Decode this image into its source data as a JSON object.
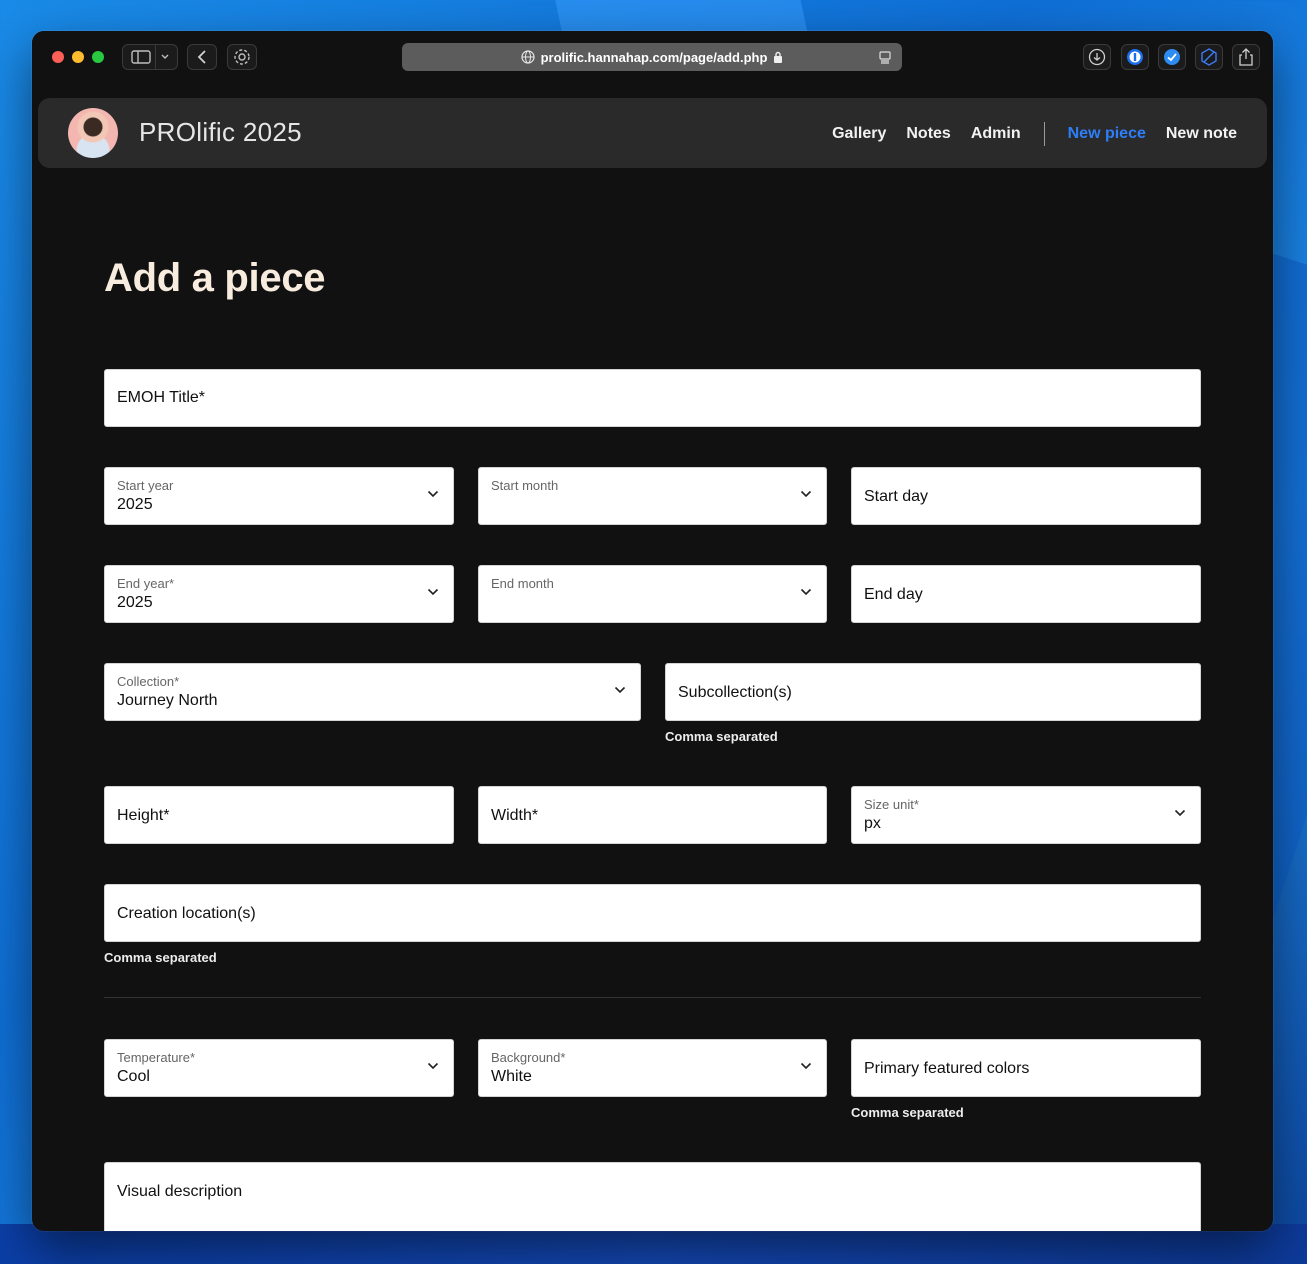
{
  "browser": {
    "url": "prolific.hannahap.com/page/add.php"
  },
  "site": {
    "brand": "PROlific 2025",
    "nav": {
      "gallery": "Gallery",
      "notes": "Notes",
      "admin": "Admin",
      "new_piece": "New piece",
      "new_note": "New note"
    }
  },
  "page": {
    "title": "Add a piece"
  },
  "form": {
    "emoh_title": {
      "placeholder": "EMOH Title*"
    },
    "start_year": {
      "label": "Start year",
      "value": "2025"
    },
    "start_month": {
      "label": "Start month",
      "value": ""
    },
    "start_day": {
      "placeholder": "Start day"
    },
    "end_year": {
      "label": "End year*",
      "value": "2025"
    },
    "end_month": {
      "label": "End month",
      "value": ""
    },
    "end_day": {
      "placeholder": "End day"
    },
    "collection": {
      "label": "Collection*",
      "value": "Journey North"
    },
    "subcollections": {
      "placeholder": "Subcollection(s)",
      "help": "Comma separated"
    },
    "height": {
      "placeholder": "Height*"
    },
    "width": {
      "placeholder": "Width*"
    },
    "size_unit": {
      "label": "Size unit*",
      "value": "px"
    },
    "creation_locations": {
      "placeholder": "Creation location(s)",
      "help": "Comma separated"
    },
    "temperature": {
      "label": "Temperature*",
      "value": "Cool"
    },
    "background": {
      "label": "Background*",
      "value": "White"
    },
    "primary_colors": {
      "placeholder": "Primary featured colors",
      "help": "Comma separated"
    },
    "visual_description": {
      "placeholder": "Visual description"
    }
  },
  "colors": {
    "accent": "#2d7ff9",
    "title": "#f7ecde",
    "background": "#111111",
    "navbar": "#2a2a2a"
  }
}
